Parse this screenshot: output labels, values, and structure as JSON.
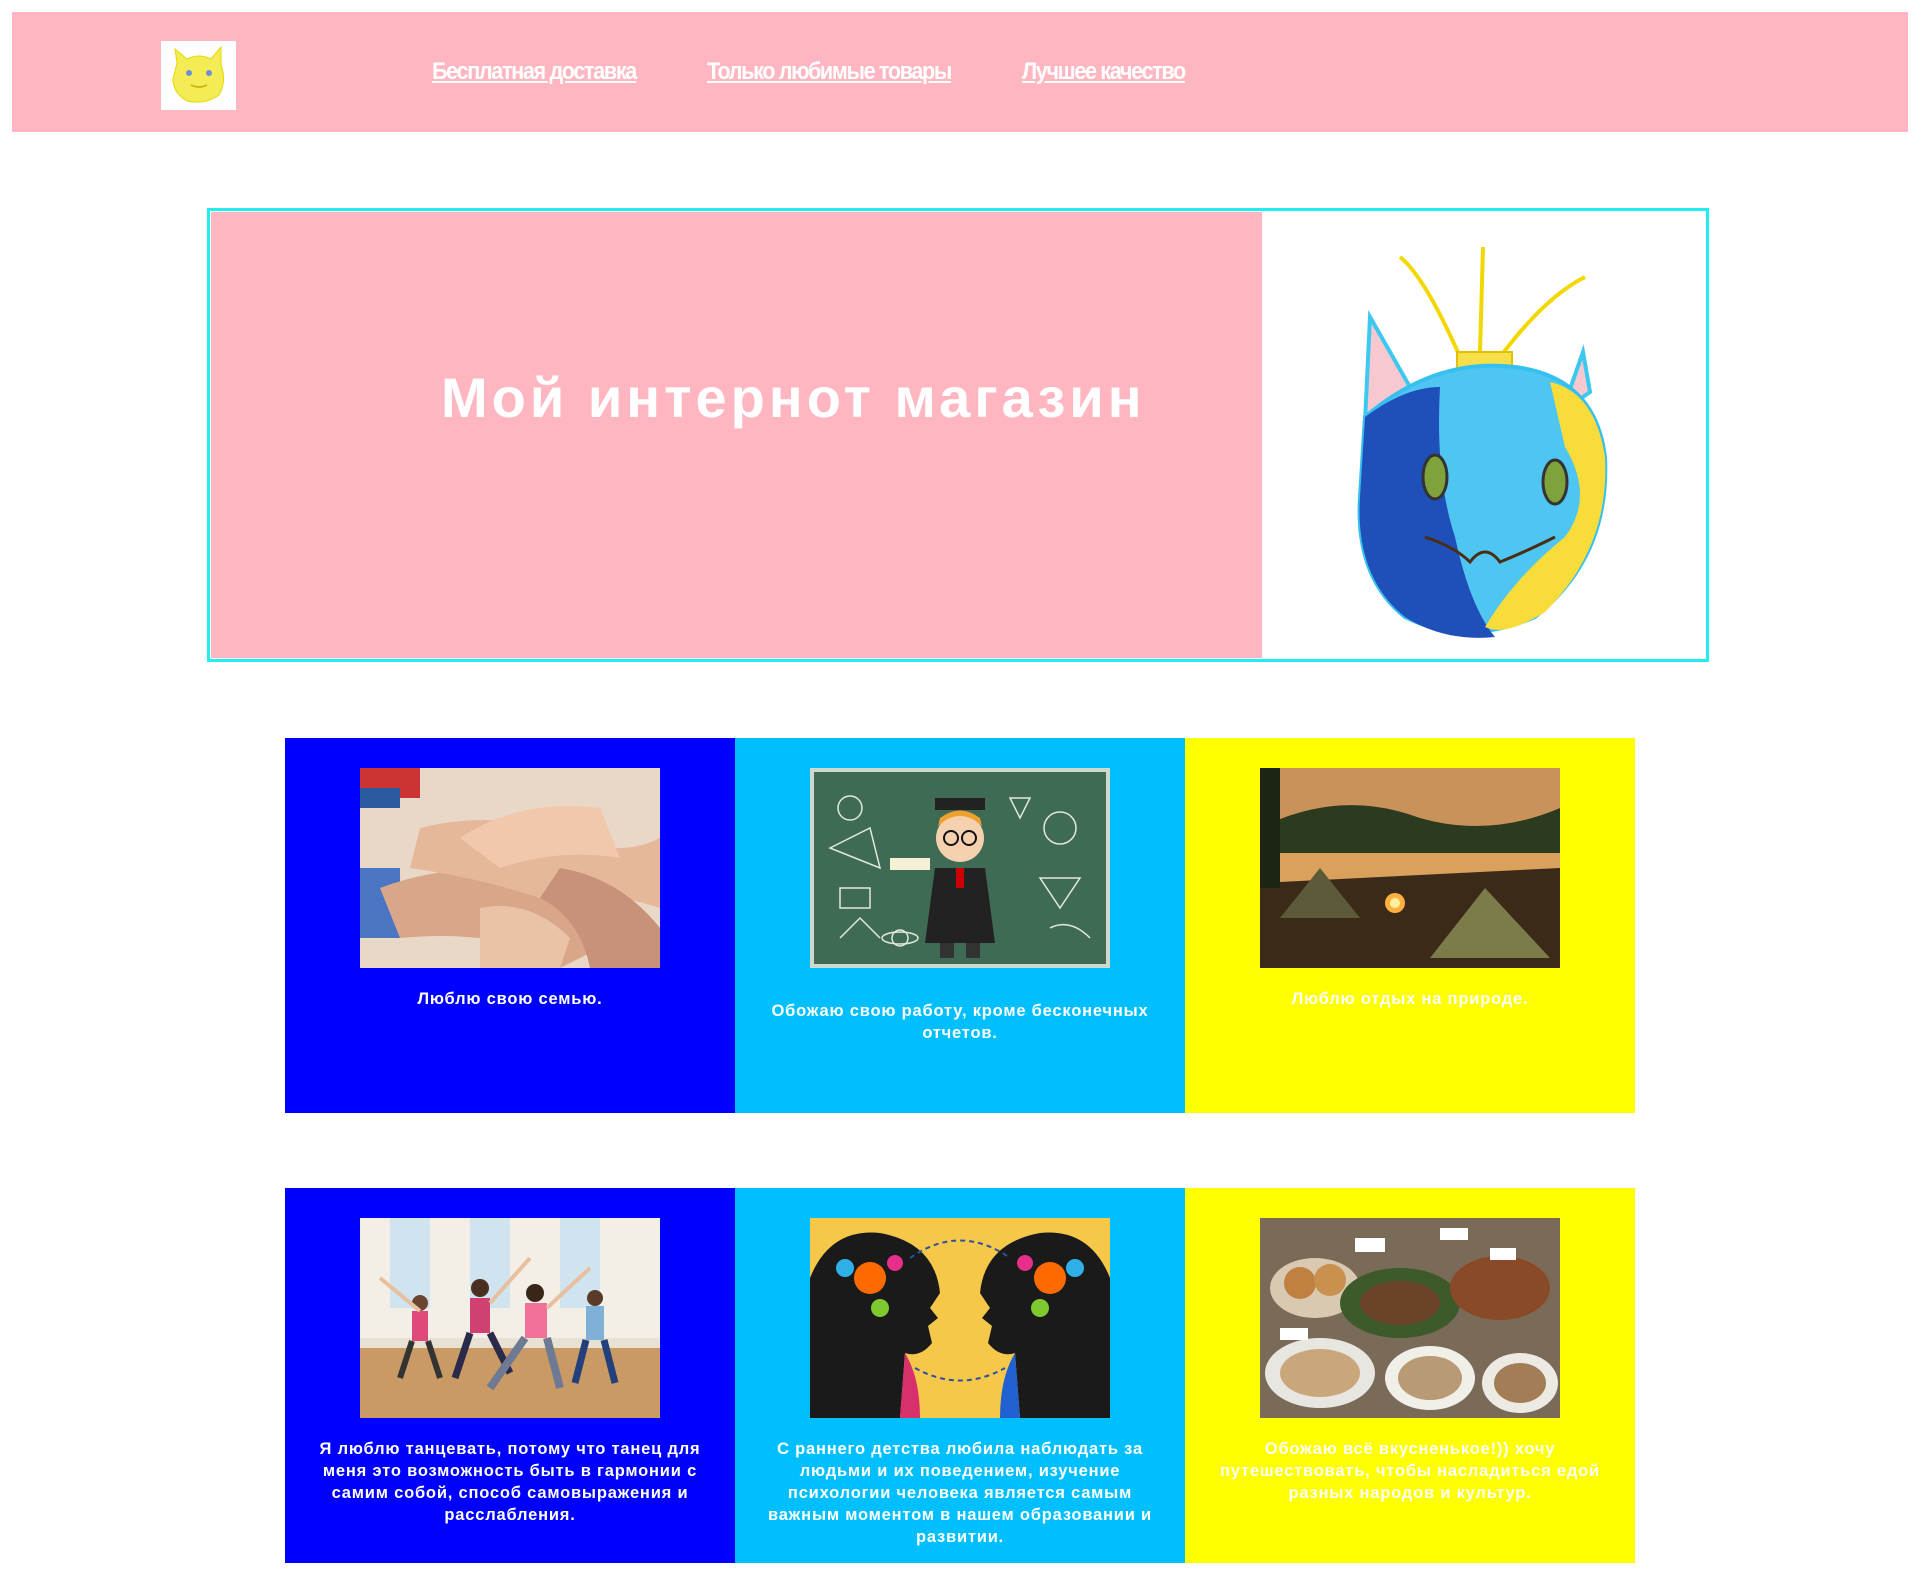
{
  "header": {
    "logo_icon": "cat-drawing-logo",
    "nav": [
      {
        "label": "Бесплатная доставка"
      },
      {
        "label": "Только любимые товары"
      },
      {
        "label": "Лучшее качество"
      }
    ]
  },
  "hero": {
    "title": "Мой интернот магазин",
    "image_icon": "cat-face-drawing"
  },
  "cards": [
    {
      "caption": "Люблю свою семью.",
      "image_icon": "family-hands-photo",
      "bg": "#0000ff"
    },
    {
      "caption": "Обожаю свою работу, кроме бесконечных отчетов.",
      "image_icon": "teacher-chalkboard-illustration",
      "bg": "#00bfff"
    },
    {
      "caption": "Люблю отдых на природе.",
      "image_icon": "camping-lake-photo",
      "bg": "#ffff00"
    },
    {
      "caption": "Я люблю танцевать, потому что танец для меня это возможность быть в гармонии с самим собой, способ самовыражения и расслабления.",
      "image_icon": "dance-class-photo",
      "bg": "#0000ff"
    },
    {
      "caption": "С раннего детства любила наблюдать за людьми и их поведением, изучение психологии человека является самым важным моментом в нашем образовании и развитии.",
      "image_icon": "psychology-heads-illustration",
      "bg": "#00bfff"
    },
    {
      "caption": "Обожаю всё вкусненькое!)) хочу путешествовать, чтобы насладиться едой разных народов и культур.",
      "image_icon": "food-table-photo",
      "bg": "#ffff00"
    }
  ],
  "colors": {
    "header_bg": "#ffb6c1",
    "hero_border": "#22ecf0",
    "blue": "#0000ff",
    "cyan": "#00bfff",
    "yellow": "#ffff00"
  }
}
